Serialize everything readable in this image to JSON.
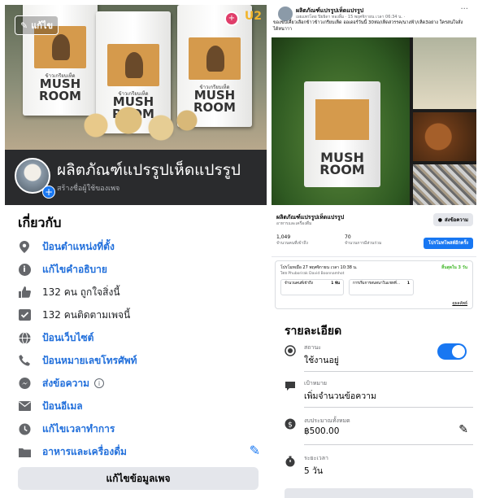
{
  "cover": {
    "edit_label": "แก้ไข",
    "bag_brand": "MUSH ROOM",
    "bag_sub": "ข้าวเกรียบเห็ด",
    "badge_1": "+",
    "badge_2": "U2"
  },
  "page": {
    "name": "ผลิตภัณฑ์แปรรูปเห็ดแปรรูป",
    "username_prompt": "สร้างชื่อผู้ใช้ของเพจ"
  },
  "about": {
    "title": "เกี่ยวกับ",
    "items": [
      {
        "icon": "location-pin-icon",
        "text": "ป้อนตำแหน่งที่ตั้ง",
        "link": true
      },
      {
        "icon": "info-icon",
        "text": "แก้ไขคำอธิบาย",
        "link": true
      },
      {
        "icon": "thumbs-up-icon",
        "text": "132 คน ถูกใจสิ่งนี้",
        "link": false
      },
      {
        "icon": "follow-check-icon",
        "text": "132 คนติดตามเพจนี้",
        "link": false
      },
      {
        "icon": "globe-icon",
        "text": "ป้อนเว็บไซต์",
        "link": true
      },
      {
        "icon": "phone-icon",
        "text": "ป้อนหมายเลขโทรศัพท์",
        "link": true
      },
      {
        "icon": "messenger-icon",
        "text": "ส่งข้อความ",
        "link": true
      },
      {
        "icon": "email-icon",
        "text": "ป้อนอีเมล",
        "link": true
      },
      {
        "icon": "clock-icon",
        "text": "แก้ไขเวลาทำการ",
        "link": true
      },
      {
        "icon": "category-icon",
        "text": "อาหารและเครื่องดื่ม",
        "link": true
      }
    ],
    "edit_page_button": "แก้ไขข้อมูลเพจ"
  },
  "post": {
    "author": "ผลิตภัณฑ์แปรรูปเห็ดแปรรูป",
    "meta": "เผยแพร่โดย ปิยธิดา ทองลิ้ม · 15 พฤศจิกายน เวลา 06:34 น. ·",
    "text": "ของขบเคี้ยวเลือกข้าวข้าวเกรียบเห็ด ออเดอร์วันนี้ 30ห่อ/เห็ดสวรรค/นางฟ้า/เห็ด3อย่าง ใครสนใจสั่งได้หนาาา",
    "more": "···",
    "photo_brand": "MUSH ROOM"
  },
  "page_card": {
    "name": "ผลิตภัณฑ์แปรรูปเห็ดแปรรูป",
    "category": "อาหารและเครื่องดื่ม",
    "message_button": "ส่งข้อความ",
    "stat_1_value": "1,049",
    "stat_1_label": "จำนวนคนที่เข้าถึง",
    "stat_2_value": "70",
    "stat_2_label": "จำนวนการมีส่วนร่วม",
    "boost_button": "โปรโมทโพสต์อีกครั้ง"
  },
  "promotion": {
    "date": "โปรโมทเมื่อ 27 พฤศจิกายน เวลา 10:38 น.",
    "by": "โดย Phuborirak David Boonnamhot",
    "status": "สิ้นสุดใน 3 วัน",
    "cell_1_label": "จำนวนคนที่เข้าถึง",
    "cell_1_value": "1 พัน",
    "cell_2_label": "การเริ่มการสนทนาในแชทที่...",
    "cell_2_value": "1",
    "details_link": "ดูผลลัพธ์"
  },
  "details": {
    "title": "รายละเอียด",
    "status_label": "สถานะ",
    "status_value": "ใช้งานอยู่",
    "status_on": true,
    "goal_label": "เป้าหมาย",
    "goal_value": "เพิ่มจำนวนข้อความ",
    "budget_label": "งบประมาณทั้งหมด",
    "budget_value": "฿500.00",
    "duration_label": "ระยะเวลา",
    "duration_value": "5 วัน"
  },
  "colors": {
    "link_blue": "#216fdb",
    "facebook_blue": "#1877f2",
    "header_dark": "#2a2b2d"
  }
}
